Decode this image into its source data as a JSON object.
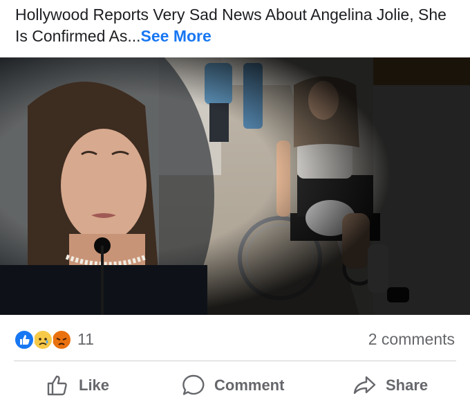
{
  "post": {
    "text": "Hollywood Reports Very Sad News About Angelina Jolie, She Is Confirmed As...",
    "see_more": "See More"
  },
  "reactions": {
    "icons": [
      "like-icon",
      "sad-icon",
      "angry-icon"
    ],
    "count": "11",
    "comments": "2 comments"
  },
  "actions": {
    "like": "Like",
    "comment": "Comment",
    "share": "Share"
  },
  "colors": {
    "link": "#1877f2",
    "muted_text": "#65676b",
    "like_reaction": "#1877f2",
    "sad_reaction": "#f7c948",
    "angry_reaction": "#e9710f"
  }
}
